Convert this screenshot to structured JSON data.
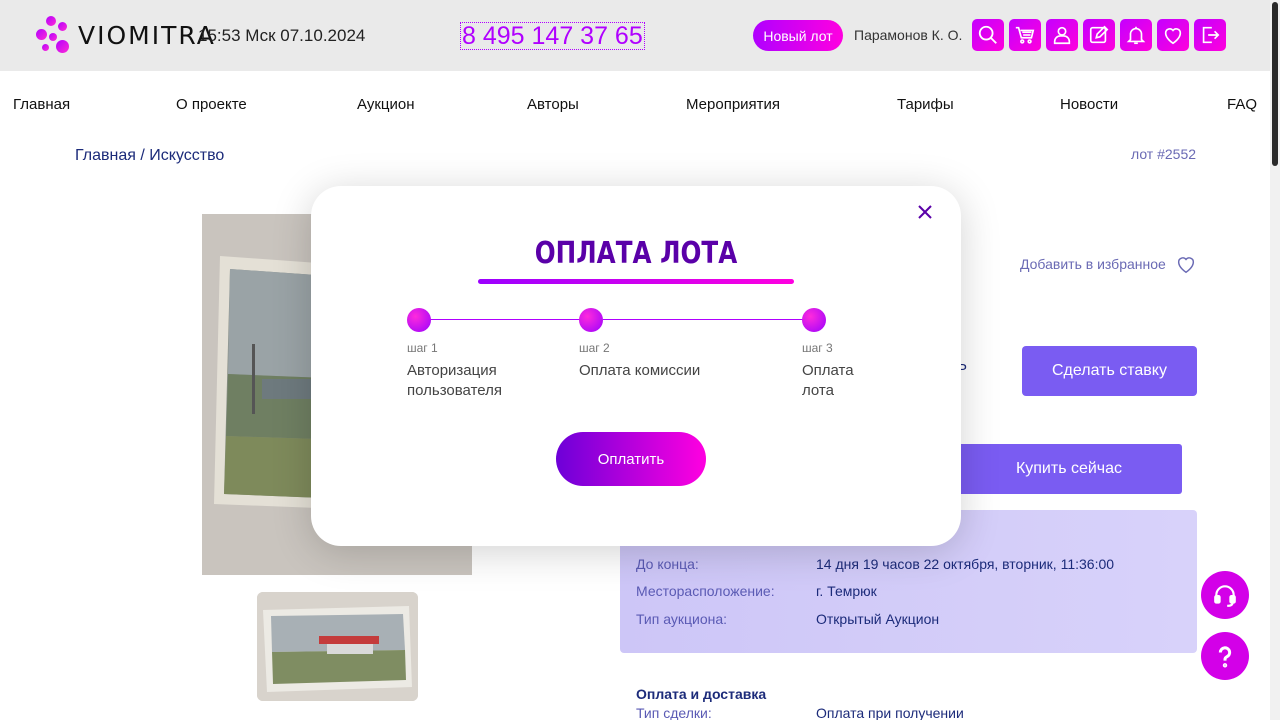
{
  "header": {
    "logo_text": "VIOMITRA",
    "clock": "15:53 Мск 07.10.2024",
    "phone": "8 495 147 37 65",
    "new_lot_label": "Новый лот",
    "username": "Парамонов К. О.",
    "icons": [
      "search-icon",
      "cart-icon",
      "user-icon",
      "edit-icon",
      "bell-icon",
      "heart-icon",
      "logout-icon"
    ]
  },
  "nav": {
    "items": [
      "Главная",
      "О проекте",
      "Аукцион",
      "Авторы",
      "Мероприятия",
      "Тарифы",
      "Новости",
      "FAQ"
    ]
  },
  "breadcrumb": {
    "home": "Главная",
    "separator": "/",
    "current": "Искусство"
  },
  "lot": {
    "number": "лот #2552",
    "add_favorite": "Добавить в избранное",
    "partial_text": "Р",
    "bid_label": "Сделать ставку",
    "buy_label": "Купить сейчас",
    "info": [
      {
        "key": "До конца:",
        "value": "14 дня 19 часов 22 октября, вторник, 11:36:00"
      },
      {
        "key": "Месторасположение:",
        "value": "г. Темрюк"
      },
      {
        "key": "Тип аукциона:",
        "value": "Открытый Аукцион"
      }
    ],
    "payment_title": "Оплата и доставка",
    "deal_key": "Тип сделки:",
    "deal_value": "Оплата при получении"
  },
  "modal": {
    "title": "ОПЛАТА ЛОТА",
    "steps": [
      {
        "num": "шаг 1",
        "label": "Авторизация пользователя"
      },
      {
        "num": "шаг 2",
        "label": "Оплата комиссии"
      },
      {
        "num": "шаг 3",
        "label": "Оплата лота"
      }
    ],
    "pay_label": "Оплатить"
  },
  "colors": {
    "accent": "#b000ff",
    "accent2": "#ff00e0",
    "button": "#7a5cf2",
    "title": "#5a00a8"
  }
}
